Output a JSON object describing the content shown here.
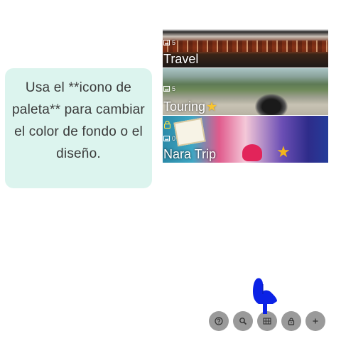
{
  "tooltip": {
    "text": "Usa el **icono de paleta** para cambiar el color de fondo o el diseño."
  },
  "albums": [
    {
      "title": "Travel",
      "count": "5",
      "favorite": false,
      "locked": false
    },
    {
      "title": "Touring",
      "count": "5",
      "favorite": true,
      "locked": false
    },
    {
      "title": "Nara Trip",
      "count": "0",
      "favorite": false,
      "locked": true,
      "corner_star": true
    }
  ],
  "toolbar": {
    "buttons": [
      {
        "icon": "help-icon"
      },
      {
        "icon": "search-icon"
      },
      {
        "icon": "palette-grid-icon"
      },
      {
        "icon": "lock-icon"
      },
      {
        "icon": "plus-icon"
      }
    ]
  },
  "colors": {
    "tooltip_bg": "#dcf4ee",
    "toolbar_button_bg": "#9a9a9a",
    "pointer_hand": "#0b22e6",
    "star": "#f8c531"
  }
}
